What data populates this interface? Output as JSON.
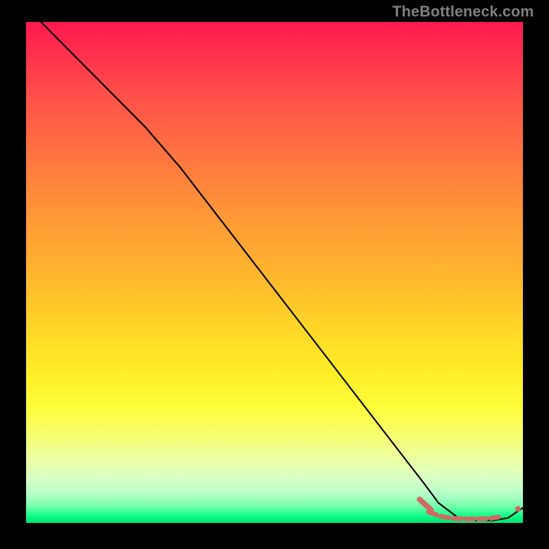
{
  "watermark": "TheBottleneck.com",
  "colors": {
    "background": "#000000",
    "watermark": "#808080",
    "curve": "#000000",
    "dash_marker": "#cf6a63",
    "end_dot": "#cf6a63"
  },
  "chart_data": {
    "type": "line",
    "title": "",
    "xlabel": "",
    "ylabel": "",
    "xlim": [
      0,
      100
    ],
    "ylim": [
      0,
      100
    ],
    "grid": false,
    "series": [
      {
        "name": "main-curve",
        "x": [
          3,
          10,
          17,
          24,
          31,
          38,
          45,
          52,
          59,
          66,
          73,
          80,
          83,
          87,
          90,
          94,
          97,
          100
        ],
        "values": [
          100,
          93,
          86,
          79,
          71,
          62,
          53,
          44,
          35,
          26,
          17,
          8,
          4,
          1,
          0.5,
          0.5,
          1,
          3
        ]
      },
      {
        "name": "bottom-dash",
        "x": [
          81,
          83.5,
          86,
          88.5,
          91,
          93.5,
          96
        ],
        "values": [
          2.2,
          1.3,
          0.9,
          0.8,
          0.8,
          0.9,
          1.3
        ]
      }
    ],
    "end_marker": {
      "x": 99,
      "y": 2.8
    }
  }
}
